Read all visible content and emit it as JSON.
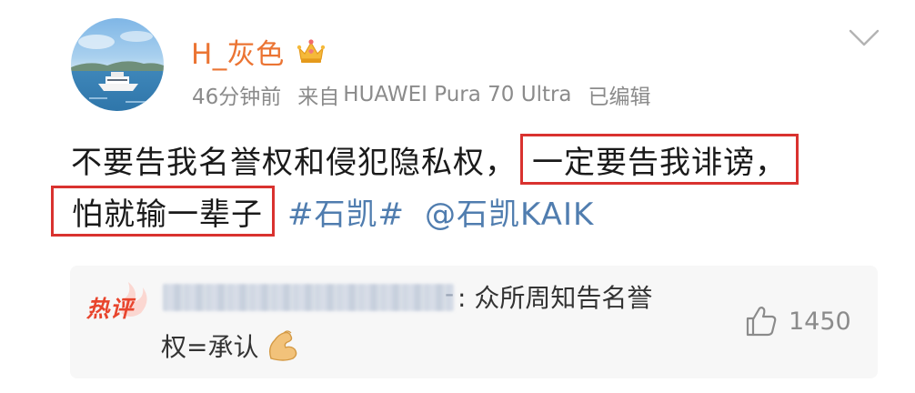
{
  "post": {
    "username": "H_灰色",
    "meta": {
      "time": "46分钟前",
      "source_prefix": "来自",
      "device": "HUAWEI Pura 70 Ultra",
      "edited": "已编辑"
    },
    "body": {
      "line1_plain": "不要告我名誉权和侵犯隐私权，",
      "line1_boxed": "一定要告我诽谤，",
      "line2_boxed": "怕就输一辈子",
      "topic": "#石凯#",
      "mention": "@石凯KAIK"
    },
    "highlight_color": "#d9322f",
    "username_color": "#eb7433",
    "link_color": "#507daf"
  },
  "hot_comment": {
    "badge": "热评",
    "commenter_suffix": "-",
    "text_line1": ": 众所周知告名誉",
    "text_line2": "权=承认",
    "emoji": "flexed-biceps",
    "likes": "1450"
  },
  "icons": {
    "crown": "crown-icon",
    "chevron": "chevron-down-icon",
    "like": "thumbs-up-icon"
  }
}
